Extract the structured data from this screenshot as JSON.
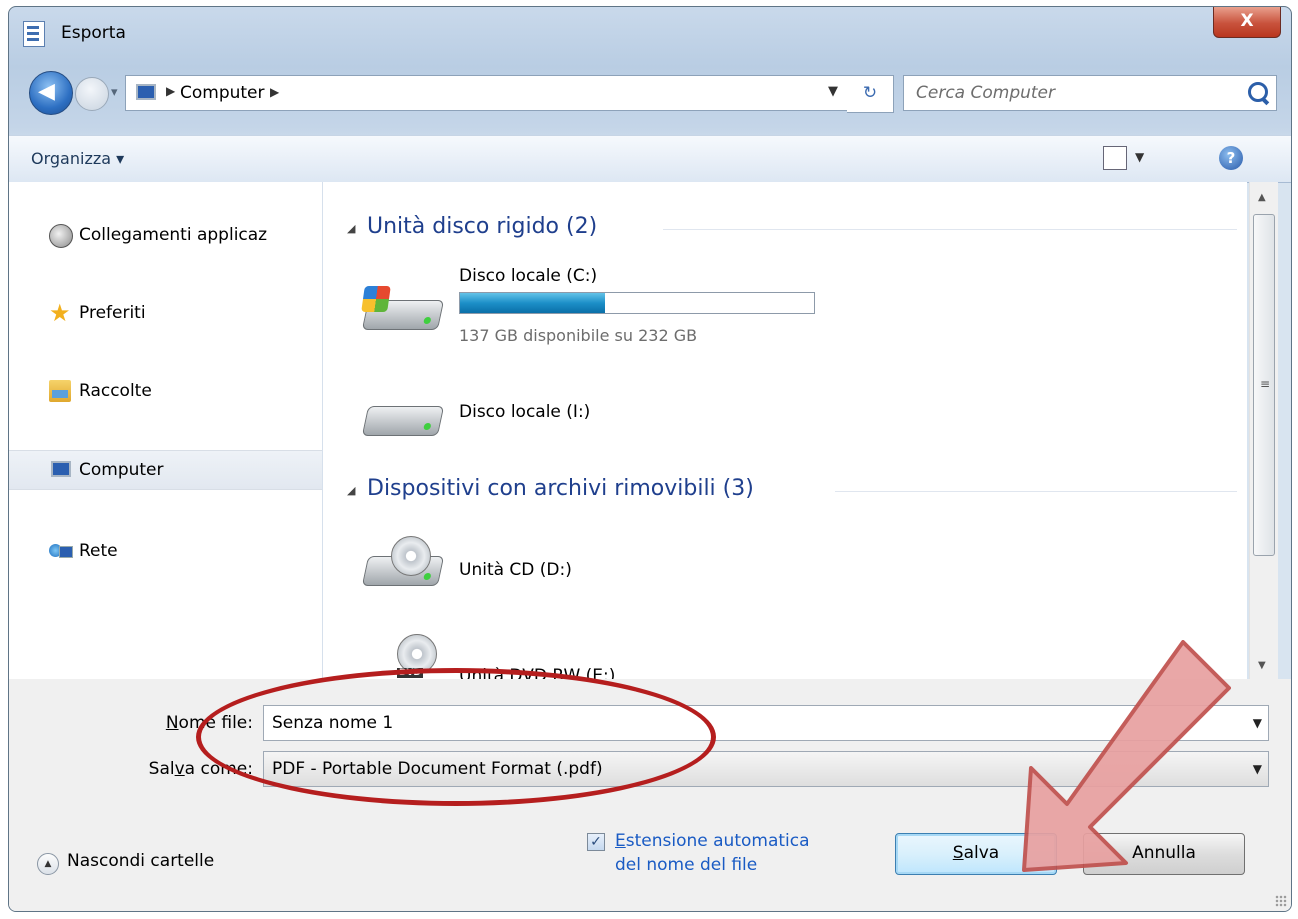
{
  "window": {
    "title": "Esporta",
    "close_label": "X"
  },
  "nav": {
    "breadcrumb": "Computer",
    "search_placeholder": "Cerca Computer"
  },
  "toolbar": {
    "organize_label": "Organizza ▾",
    "help_label": "?"
  },
  "sidebar": {
    "items": [
      {
        "label": "Collegamenti applicaz",
        "icon": "globe-icon",
        "selected": false
      },
      {
        "label": "Preferiti",
        "icon": "star-icon",
        "selected": false
      },
      {
        "label": "Raccolte",
        "icon": "libraries-icon",
        "selected": false
      },
      {
        "label": "Computer",
        "icon": "computer-icon",
        "selected": true
      },
      {
        "label": "Rete",
        "icon": "network-icon",
        "selected": false
      }
    ]
  },
  "content": {
    "groups": [
      {
        "title": "Unità disco rigido (2)"
      },
      {
        "title": "Dispositivi con archivi rimovibili (3)"
      }
    ],
    "drives": [
      {
        "name": "Disco locale (C:)",
        "free_text": "137 GB disponibile su 232 GB",
        "used_fraction": 0.41,
        "icon": "system-drive-icon"
      },
      {
        "name": "Disco locale (I:)",
        "icon": "hard-drive-icon"
      },
      {
        "name": "Unità CD (D:)",
        "icon": "cd-drive-icon"
      },
      {
        "name": "Unità DVD RW (E:)",
        "icon": "dvd-drive-icon",
        "badge": "DVD"
      }
    ]
  },
  "form": {
    "filename_label_ul": "N",
    "filename_label_rest": "ome file:",
    "filename_value": "Senza nome 1",
    "saveas_label_pre": "Sal",
    "saveas_label_ul": "v",
    "saveas_label_rest": "a come:",
    "saveas_value": "PDF - Portable Document Format (.pdf)",
    "hide_folders_label": "Nascondi cartelle",
    "auto_ext_ul": "E",
    "auto_ext_line1_rest": "stensione automatica",
    "auto_ext_line2": "del nome del file",
    "auto_ext_checked": true,
    "save_ul": "S",
    "save_rest": "alva",
    "cancel_label": "Annulla"
  },
  "colors": {
    "annotation_ellipse": "#b51e1e",
    "annotation_arrow_fill": "#e8a0a0",
    "annotation_arrow_stroke": "#c0504d"
  }
}
